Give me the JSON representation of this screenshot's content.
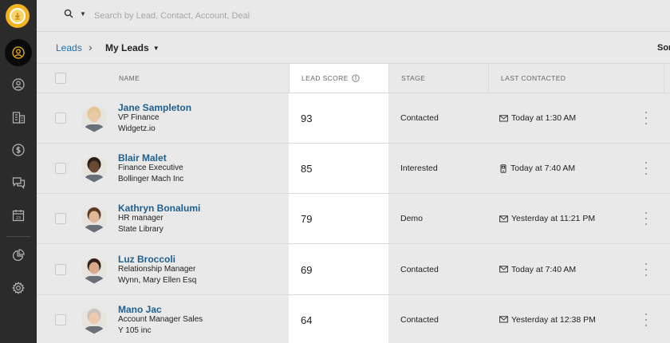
{
  "sidebar": {
    "logo_icon": "coin-logo-icon",
    "items": [
      {
        "icon": "user-circle-icon",
        "active": true
      },
      {
        "icon": "person-icon",
        "active": false
      },
      {
        "icon": "building-icon",
        "active": false
      },
      {
        "icon": "dollar-circle-icon",
        "active": false
      },
      {
        "icon": "chat-icon",
        "active": false
      },
      {
        "icon": "calendar-icon",
        "active": false
      },
      {
        "icon": "pie-chart-icon",
        "active": false
      },
      {
        "icon": "gear-icon",
        "active": false
      }
    ]
  },
  "search": {
    "placeholder": "Search by Lead, Contact, Account, Deal",
    "value": ""
  },
  "breadcrumb": {
    "root": "Leads",
    "separator": "›",
    "current": "My Leads",
    "sort_label": "Sor"
  },
  "table": {
    "columns": {
      "name": "NAME",
      "lead_score": "LEAD SCORE",
      "stage": "STAGE",
      "last_contacted": "LAST CONTACTED"
    },
    "rows": [
      {
        "name": "Jane Sampleton",
        "title": "VP Finance",
        "company": "Widgetz.io",
        "score": "93",
        "stage": "Contacted",
        "contact_icon": "envelope-icon",
        "last_contacted": "Today at 1:30 AM",
        "avatar_color": "#e8c9a8",
        "hair_color": "#e3c690"
      },
      {
        "name": "Blair Malet",
        "title": "Finance Executive",
        "company": "Bollinger Mach Inc",
        "score": "85",
        "stage": "Interested",
        "contact_icon": "phone-icon",
        "last_contacted": "Today at 7:40 AM",
        "avatar_color": "#6b4a35",
        "hair_color": "#2a1d16"
      },
      {
        "name": "Kathryn Bonalumi",
        "title": "HR manager",
        "company": "State Library",
        "score": "79",
        "stage": "Demo",
        "contact_icon": "envelope-icon",
        "last_contacted": "Yesterday at 11:21 PM",
        "avatar_color": "#e0b898",
        "hair_color": "#5a3a24"
      },
      {
        "name": "Luz Broccoli",
        "title": "Relationship Manager",
        "company": "Wynn, Mary Ellen Esq",
        "score": "69",
        "stage": "Contacted",
        "contact_icon": "envelope-icon",
        "last_contacted": "Today at 7:40 AM",
        "avatar_color": "#d9a98a",
        "hair_color": "#2e1f18"
      },
      {
        "name": "Mano Jac",
        "title": "Account Manager Sales",
        "company": "Y 105 inc",
        "score": "64",
        "stage": "Contacted",
        "contact_icon": "envelope-icon",
        "last_contacted": "Yesterday at 12:38 PM",
        "avatar_color": "#edc9b0",
        "hair_color": "#c9c2b8"
      }
    ]
  },
  "colors": {
    "sidebar_bg": "#2b2b2b",
    "link_blue": "#1d5f8f",
    "logo_gold": "#f2b320",
    "page_bg": "#e9e9e9"
  }
}
